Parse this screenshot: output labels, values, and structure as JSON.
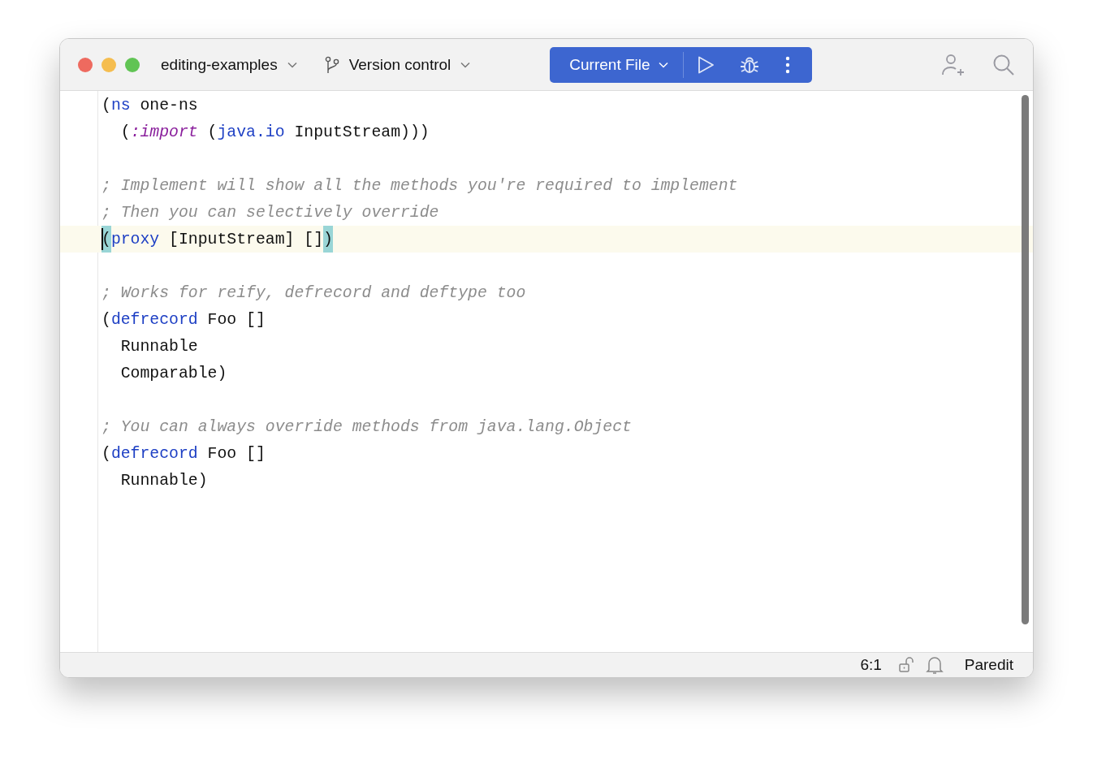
{
  "window": {
    "project": "editing-examples",
    "vcs": "Version control",
    "run_config": "Current File"
  },
  "editor": {
    "lines": [
      {
        "current": false,
        "tokens": [
          {
            "kind": "plain",
            "text": "("
          },
          {
            "kind": "keyword",
            "text": "ns"
          },
          {
            "kind": "plain",
            "text": " one-ns"
          }
        ]
      },
      {
        "current": false,
        "tokens": [
          {
            "kind": "plain",
            "text": "  ("
          },
          {
            "kind": "keyword_italic",
            "text": ":import"
          },
          {
            "kind": "plain",
            "text": " ("
          },
          {
            "kind": "keyword",
            "text": "java.io"
          },
          {
            "kind": "plain",
            "text": " InputStream)))"
          }
        ]
      },
      {
        "current": false
      },
      {
        "current": false,
        "tokens": [
          {
            "kind": "comment",
            "text": "; Implement will show all the methods you're required to implement"
          }
        ]
      },
      {
        "current": false,
        "tokens": [
          {
            "kind": "comment",
            "text": "; Then you can selectively override"
          }
        ]
      },
      {
        "current": true,
        "caret": true,
        "tokens": [
          {
            "kind": "brace_match",
            "text": "("
          },
          {
            "kind": "keyword",
            "text": "proxy"
          },
          {
            "kind": "plain",
            "text": " [InputStream] []"
          },
          {
            "kind": "brace_match",
            "text": ")"
          }
        ]
      },
      {
        "current": false
      },
      {
        "current": false,
        "tokens": [
          {
            "kind": "comment",
            "text": "; Works for reify, defrecord and deftype too"
          }
        ]
      },
      {
        "current": false,
        "tokens": [
          {
            "kind": "plain",
            "text": "("
          },
          {
            "kind": "keyword",
            "text": "defrecord"
          },
          {
            "kind": "plain",
            "text": " Foo []"
          }
        ]
      },
      {
        "current": false,
        "tokens": [
          {
            "kind": "plain",
            "text": "  Runnable"
          }
        ]
      },
      {
        "current": false,
        "tokens": [
          {
            "kind": "plain",
            "text": "  Comparable)"
          }
        ]
      },
      {
        "current": false
      },
      {
        "current": false,
        "tokens": [
          {
            "kind": "comment",
            "text": "; You can always override methods from java.lang.Object"
          }
        ]
      },
      {
        "current": false,
        "tokens": [
          {
            "kind": "plain",
            "text": "("
          },
          {
            "kind": "keyword",
            "text": "defrecord"
          },
          {
            "kind": "plain",
            "text": " Foo []"
          }
        ]
      },
      {
        "current": false,
        "tokens": [
          {
            "kind": "plain",
            "text": "  Runnable)"
          }
        ]
      }
    ]
  },
  "status_bar": {
    "position": "6:1",
    "mode": "Paredit"
  }
}
